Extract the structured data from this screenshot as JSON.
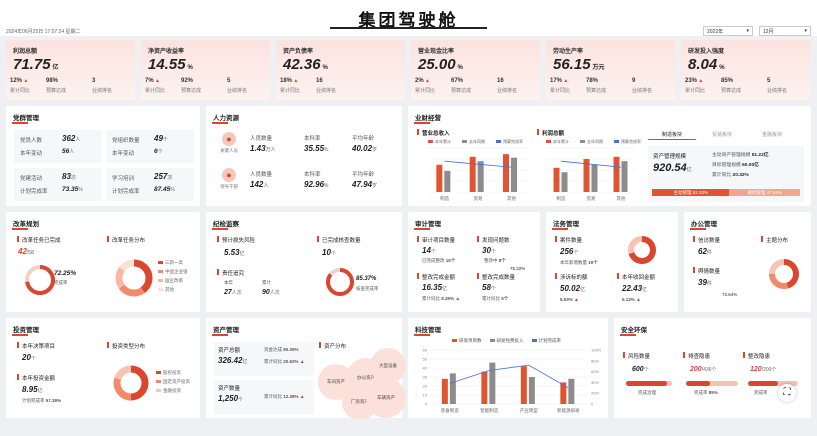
{
  "header": {
    "datetime": "2024年06月25日 17:07:24 星期二",
    "title": "集团驾驶舱",
    "year_select": "2022年",
    "month_select": "12月"
  },
  "kpis": [
    {
      "title": "利润总额",
      "value": "71.75",
      "unit": "亿",
      "a": "12%",
      "a_lbl": "累计同比",
      "b": "98%",
      "b_lbl": "预算达成",
      "c": "3",
      "c_lbl": "业绩排名"
    },
    {
      "title": "净资产收益率",
      "value": "14.55",
      "unit": "%",
      "a": "7%",
      "a_lbl": "累计同比",
      "b": "92%",
      "b_lbl": "预算达成",
      "c": "5",
      "c_lbl": "业绩排名"
    },
    {
      "title": "资产负债率",
      "value": "42.36",
      "unit": "%",
      "a": "18%",
      "a_lbl": "累计同比",
      "b": "16",
      "b_lbl": "业绩排名",
      "c": "",
      "c_lbl": ""
    },
    {
      "title": "营业现金比率",
      "value": "25.00",
      "unit": "%",
      "a": "2%",
      "a_lbl": "累计同比",
      "b": "67%",
      "b_lbl": "预算达成",
      "c": "16",
      "c_lbl": "业绩排名"
    },
    {
      "title": "劳动生产率",
      "value": "56.15",
      "unit": "万元",
      "a": "17%",
      "a_lbl": "累计同比",
      "b": "78%",
      "b_lbl": "预算达成",
      "c": "9",
      "c_lbl": "业绩排名"
    },
    {
      "title": "研发投入强度",
      "value": "8.04",
      "unit": "%",
      "a": "23%",
      "a_lbl": "累计同比",
      "b": "85%",
      "b_lbl": "预算达成",
      "c": "5",
      "c_lbl": "业绩排名"
    }
  ],
  "party": {
    "title": "党群管理",
    "items": [
      {
        "l1": "党员人数",
        "v1": "362",
        "u1": "人",
        "l2": "本年变动",
        "v2": "56",
        "u2": "人"
      },
      {
        "l1": "党组织数量",
        "v1": "49",
        "u1": "个",
        "l2": "本年变动",
        "v2": "6",
        "u2": "个"
      },
      {
        "l1": "党建活动",
        "v1": "83",
        "u1": "次",
        "l2": "计划完成率",
        "v2": "73.35",
        "u2": "%"
      },
      {
        "l1": "学习培训",
        "v1": "257",
        "u1": "次",
        "l2": "计划完成率",
        "v2": "87.45",
        "u2": "%"
      }
    ]
  },
  "hr": {
    "title": "人力资源",
    "rows": [
      {
        "tag": "关键人员",
        "l1": "人员数量",
        "v1": "1.43",
        "u1": "万人",
        "l2": "本科率",
        "v2": "35.55",
        "u2": "%",
        "l3": "平均年龄",
        "v3": "40.02",
        "u3": "岁"
      },
      {
        "tag": "领导干部",
        "l1": "人员数量",
        "v1": "142",
        "u1": "人",
        "l2": "本科率",
        "v2": "92.96",
        "u2": "%",
        "l3": "平均年龄",
        "v3": "47.94",
        "u3": "岁"
      }
    ]
  },
  "business": {
    "title": "业财经营",
    "left_chart": {
      "title": "营业总收入",
      "legend": [
        "本年累计",
        "去年同期",
        "预算完成率"
      ],
      "categories": [
        "制造",
        "贸易",
        "其他"
      ],
      "series": [
        {
          "name": "本年累计",
          "values": [
            62,
            80,
            86
          ]
        },
        {
          "name": "去年同期",
          "values": [
            48,
            70,
            78
          ]
        }
      ]
    },
    "right_chart": {
      "title": "利润总额",
      "legend": [
        "本年累计",
        "去年同期",
        "预算完成率"
      ],
      "categories": [
        "制造",
        "贸易",
        "其他"
      ],
      "series": [
        {
          "name": "本年累计",
          "values": [
            55,
            75,
            80
          ]
        },
        {
          "name": "去年同期",
          "values": [
            45,
            62,
            70
          ]
        }
      ]
    },
    "tabs": [
      "制造板块",
      "贸易板块",
      "金融板块"
    ],
    "asset_scale_label": "资产管理规模",
    "asset_scale_value": "920.54",
    "asset_scale_unit": "亿",
    "asset_rows": [
      {
        "l": "主动资产管理规模",
        "v": "51.22亿"
      },
      {
        "l": "目标管理规模",
        "v": "60.00亿"
      },
      {
        "l": "累计同比",
        "v": "20.32%"
      }
    ],
    "split": [
      {
        "l": "主动管理",
        "v": "52.33%"
      },
      {
        "l": "被动管理",
        "v": "47.64%"
      }
    ]
  },
  "reform": {
    "title": "改革规划",
    "left_label": "改革任务已完成",
    "count": "42",
    "total": "/58",
    "pct": "72.25%",
    "pct_lbl": "完成率",
    "right_label": "改革任务分布",
    "legend": [
      "三新一高",
      "中国企业强",
      "国企改革",
      "其他"
    ]
  },
  "discipline": {
    "title": "纪检监察",
    "l1": "预计损失风险",
    "v1": "5.53",
    "u1": "亿",
    "l2": "已完成核查数量",
    "v2": "10",
    "u2": "个",
    "l3": "责任追究",
    "sub1": "本年",
    "sv1": "27",
    "su1": "人次",
    "sub2": "累计",
    "sv2": "90",
    "su2": "人次",
    "pct": "85.37%",
    "pct_lbl": "核查完成率"
  },
  "audit": {
    "title": "审计管理",
    "l1": "审计项目数量",
    "v1": "14",
    "u1": "个",
    "l2": "发现问题数",
    "v2": "30",
    "u2": "个",
    "done": "15个",
    "done_lbl": "已完成整改",
    "ing": "8个",
    "ing_lbl": "整改中",
    "rate": "75.22%",
    "l3": "整改完成金额",
    "v3": "16.35",
    "u3": "亿",
    "a3": "8.35%",
    "a3_lbl": "累计同比",
    "l4": "整改完成数量",
    "v4": "58",
    "u4": "个",
    "a4": "5个",
    "a4_lbl": "累计同比"
  },
  "legal": {
    "title": "法务管理",
    "l1": "案件数量",
    "v1": "256",
    "u1": "个",
    "sub": "本年新增数量",
    "subv": "19个",
    "l2": "涉诉标的额",
    "v2": "50.02",
    "u2": "亿",
    "a2": "5.53%",
    "l3": "本年收回金额",
    "v3": "22.43",
    "u3": "亿",
    "a3": "5.13%"
  },
  "office": {
    "title": "办公管理",
    "l1": "信访数量",
    "v1": "62",
    "u1": "件",
    "l2": "舆情数量",
    "v2": "39",
    "u2": "件",
    "rate": "72.64%",
    "l3": "主题分布"
  },
  "investment": {
    "title": "投资管理",
    "l1": "本年决策项目",
    "v1": "20",
    "u1": "个",
    "l2": "本年投资金额",
    "v2": "8.95",
    "u2": "亿",
    "rate": "57.38%",
    "rate_lbl": "计划完成率",
    "l3": "投资类型分布",
    "legend": [
      "股权投资",
      "固定资产投资",
      "金融投资"
    ]
  },
  "asset": {
    "title": "资产管理",
    "l1": "资产总额",
    "v1": "326.42",
    "u1": "亿",
    "r1": "80.35%",
    "r1l": "资金达成",
    "g1": "20.62%",
    "g1l": "累计同比",
    "l2": "资产数量",
    "v2": "1,250",
    "u2": "个",
    "g2": "12.36%",
    "g2l": "累计同比",
    "l3": "资产分布",
    "bubbles": [
      "车间资产",
      "办公资产",
      "大型设备",
      "厂房资产",
      "车辆资产"
    ]
  },
  "tech": {
    "title": "科技管理",
    "legend": [
      "研发项目数",
      "研发经费投入",
      "计划完成率"
    ],
    "categories": [
      "装备制造",
      "智能制造",
      "产业转型",
      "新能源研发"
    ],
    "series": [
      {
        "name": "研发项目数",
        "values": [
          28,
          36,
          42,
          24
        ]
      },
      {
        "name": "研发经费投入",
        "values": [
          34,
          46,
          30,
          28
        ]
      },
      {
        "name": "计划完成率",
        "values": [
          38,
          62,
          72,
          30
        ]
      }
    ],
    "y_left": [
      "0",
      "10",
      "20",
      "30",
      "40",
      "50",
      "60"
    ],
    "y_right": [
      "0",
      "20%",
      "40%",
      "60%",
      "80%",
      "100%"
    ]
  },
  "safety": {
    "title": "安全环保",
    "l1": "风险数量",
    "v1": "600",
    "u1": "个",
    "s1": "完成治理",
    "l2": "排查隐患",
    "v2": "200",
    "t2": "/436",
    "u2": "个",
    "s2": "完成率",
    "p2": "85%",
    "l3": "整改隐患",
    "v3": "120",
    "t3": "/200",
    "u3": "个",
    "s3": "完成率"
  }
}
